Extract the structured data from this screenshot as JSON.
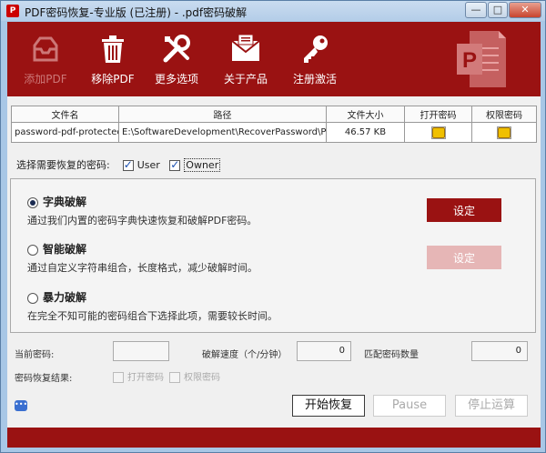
{
  "window": {
    "title": "PDF密码恢复-专业版 (已注册) - .pdf密码破解",
    "minimize_glyph": "—",
    "maximize_glyph": "□",
    "close_glyph": "✕"
  },
  "toolbar": {
    "items": [
      {
        "label": "添加PDF",
        "icon": "inbox-tray-icon",
        "enabled": false
      },
      {
        "label": "移除PDF",
        "icon": "trash-icon",
        "enabled": true
      },
      {
        "label": "更多选项",
        "icon": "tools-icon",
        "enabled": true
      },
      {
        "label": "关于产品",
        "icon": "envelope-icon",
        "enabled": true
      },
      {
        "label": "注册激活",
        "icon": "key-icon",
        "enabled": true
      }
    ],
    "logo": "pdf-logo-icon"
  },
  "file_table": {
    "headers": [
      "文件名",
      "路径",
      "文件大小",
      "打开密码",
      "权限密码"
    ],
    "rows": [
      {
        "filename": "password-pdf-protected.pd",
        "path": "E:\\SoftwareDevelopment\\RecoverPassword\\PDF Pass",
        "size": "46.57 KB"
      }
    ]
  },
  "password_select": {
    "label": "选择需要恢复的密码:",
    "user_label": "User",
    "owner_label": "Owner",
    "user_checked": true,
    "owner_checked": true
  },
  "modes": [
    {
      "title": "字典破解",
      "desc": "通过我们内置的密码字典快速恢复和破解PDF密码。",
      "selected": true,
      "button": "设定",
      "button_enabled": true
    },
    {
      "title": "智能破解",
      "desc": "通过自定义字符串组合，长度格式，减少破解时间。",
      "selected": false,
      "button": "设定",
      "button_enabled": false
    },
    {
      "title": "暴力破解",
      "desc": "在完全不知可能的密码组合下选择此项，需要较长时间。",
      "selected": false
    }
  ],
  "status": {
    "current_password_label": "当前密码:",
    "current_password_value": "",
    "speed_label": "破解速度（个/分钟）",
    "speed_value": "0",
    "match_count_label": "匹配密码数量",
    "match_count_value": "0",
    "result_label": "密码恢复结果:",
    "result_open_label": "打开密码",
    "result_perm_label": "权限密码"
  },
  "actions": {
    "start": "开始恢复",
    "pause": "Pause",
    "stop": "停止运算"
  },
  "colors": {
    "brand": "#9a1212",
    "brand_disabled": "#e6b6b6"
  }
}
